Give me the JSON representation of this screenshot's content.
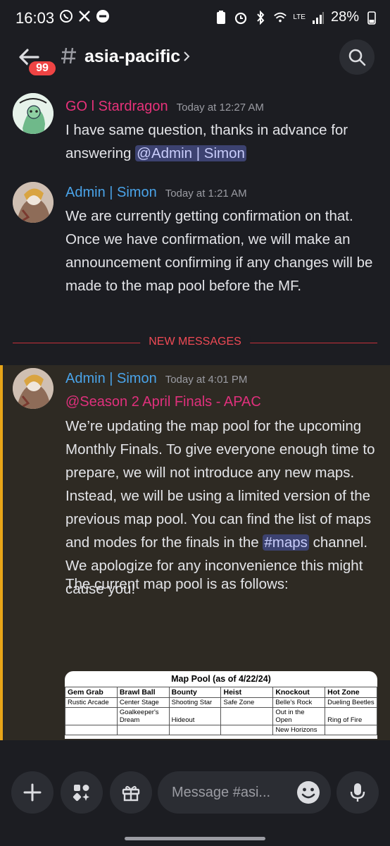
{
  "status": {
    "time": "16:03",
    "battery": "28%",
    "network": "LTE"
  },
  "header": {
    "channel": "asia-pacific",
    "badge": "99"
  },
  "messages": [
    {
      "author": "GO l Stardragon",
      "author_color": "#e8327a",
      "time": "Today at 12:27 AM",
      "text": "I have same question, thanks in advance for answering ",
      "mention": "@Admin | Simon"
    },
    {
      "author": "Admin | Simon",
      "author_color": "#4aa3e8",
      "time": "Today at 1:21 AM",
      "text": "We are currently getting confirmation on that. Once we have confirmation, we will make an announcement confirming if any changes will be made to the map pool before the MF."
    },
    {
      "author": "Admin | Simon",
      "author_color": "#4aa3e8",
      "time": "Today at 4:01 PM",
      "role_mention": "@Season 2 April Finals - APAC",
      "text_before_channel": "We’re updating the map pool for the upcoming Monthly Finals. To give everyone enough time to prepare, we will not introduce any new maps. Instead, we will be using a limited version of the previous map pool. You can find the list of maps and modes for the finals in the ",
      "channel_mention": "#maps",
      "text_after_channel": " channel. We apologize for any inconvenience this might cause you!",
      "text_pool_intro": "The current map pool is as follows:"
    }
  ],
  "divider": "NEW MESSAGES",
  "map_pool": {
    "title": "Map Pool (as of 4/22/24)",
    "headers": [
      "Gem Grab",
      "Brawl Ball",
      "Bounty",
      "Heist",
      "Knockout",
      "Hot Zone"
    ],
    "rows": [
      [
        "Rustic Arcade",
        "Center Stage",
        "Shooting Star",
        "Safe Zone",
        "Belle's Rock",
        "Dueling Beetles"
      ],
      [
        "",
        "Goalkeeper's Dream",
        "Hideout",
        "",
        "Out in the Open",
        "Ring of Fire"
      ],
      [
        "",
        "",
        "",
        "",
        "New Horizons",
        ""
      ]
    ]
  },
  "composer": {
    "placeholder": "Message #asi..."
  }
}
